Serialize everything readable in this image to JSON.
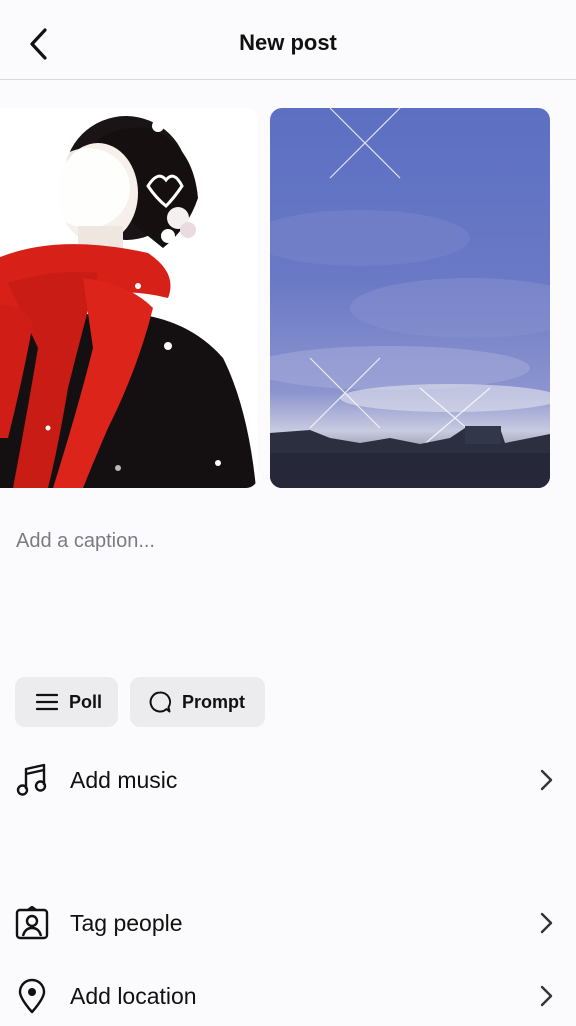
{
  "header": {
    "title": "New post",
    "back_icon": "chevron-left-icon"
  },
  "media": [
    {
      "description": "photo-portrait",
      "alt": "Person in red scarf with white flowers"
    },
    {
      "description": "photo-sky",
      "alt": "Cloudy blue sky over city"
    }
  ],
  "caption": {
    "placeholder": "Add a caption..."
  },
  "chips": [
    {
      "label": "Poll",
      "icon": "list-icon"
    },
    {
      "label": "Prompt",
      "icon": "speech-bubble-icon"
    }
  ],
  "rows": {
    "music": {
      "label": "Add music",
      "icon": "music-note-icon"
    },
    "tag": {
      "label": "Tag people",
      "icon": "person-tag-icon"
    },
    "location": {
      "label": "Add location",
      "icon": "location-pin-icon"
    }
  },
  "colors": {
    "background": "#fbfbfd",
    "chip_bg": "#ececef",
    "placeholder": "#7b7b82",
    "accent_red": "#d62018"
  }
}
